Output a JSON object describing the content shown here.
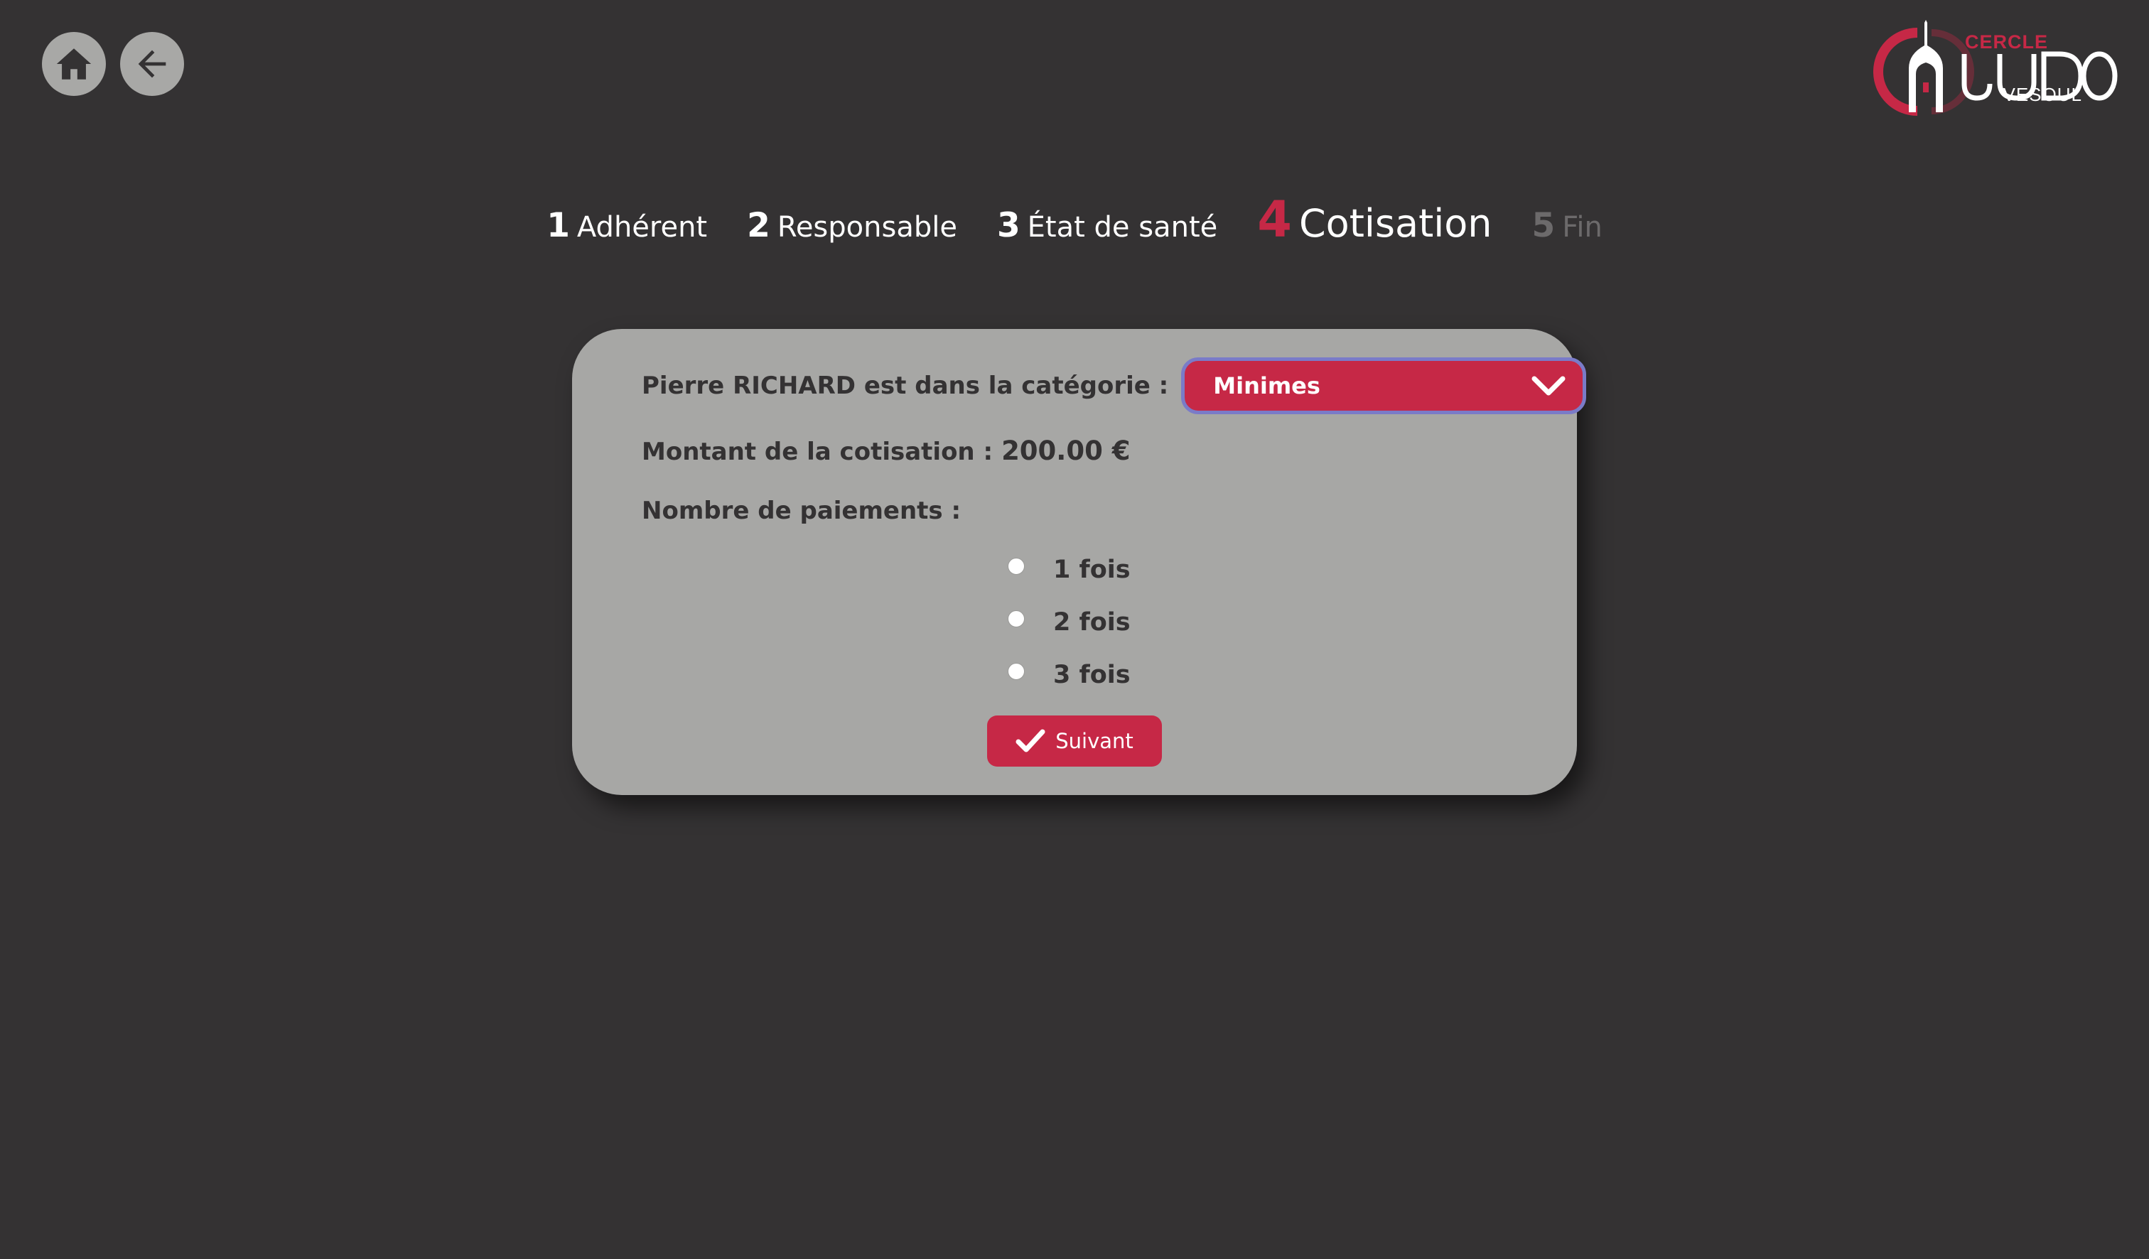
{
  "nav": {
    "home_icon": "home-icon",
    "back_icon": "arrow-left-icon"
  },
  "logo": {
    "top_text": "CERCLE",
    "main_text": "JUDO",
    "bottom_text": "VESOUL",
    "accent_color": "#c62846"
  },
  "stepper": {
    "steps": [
      {
        "number": "1",
        "label": "Adhérent",
        "state": "done"
      },
      {
        "number": "2",
        "label": "Responsable",
        "state": "done"
      },
      {
        "number": "3",
        "label": "État de santé",
        "state": "done"
      },
      {
        "number": "4",
        "label": "Cotisation",
        "state": "active"
      },
      {
        "number": "5",
        "label": "Fin",
        "state": "future"
      }
    ]
  },
  "form": {
    "category_label": "Pierre RICHARD est dans la catégorie :",
    "category_selected": "Minimes",
    "amount_label": "Montant de la cotisation :",
    "amount_value": "200.00 €",
    "payments_label": "Nombre de paiements :",
    "payment_options": [
      {
        "label": "1 fois",
        "checked": false
      },
      {
        "label": "2 fois",
        "checked": false
      },
      {
        "label": "3 fois",
        "checked": false
      }
    ],
    "submit_label": "Suivant"
  },
  "colors": {
    "background": "#343233",
    "card": "#a7a7a5",
    "accent": "#c62846",
    "focus_ring": "#7a7bc8",
    "nav_circle": "#a8a8a6"
  }
}
